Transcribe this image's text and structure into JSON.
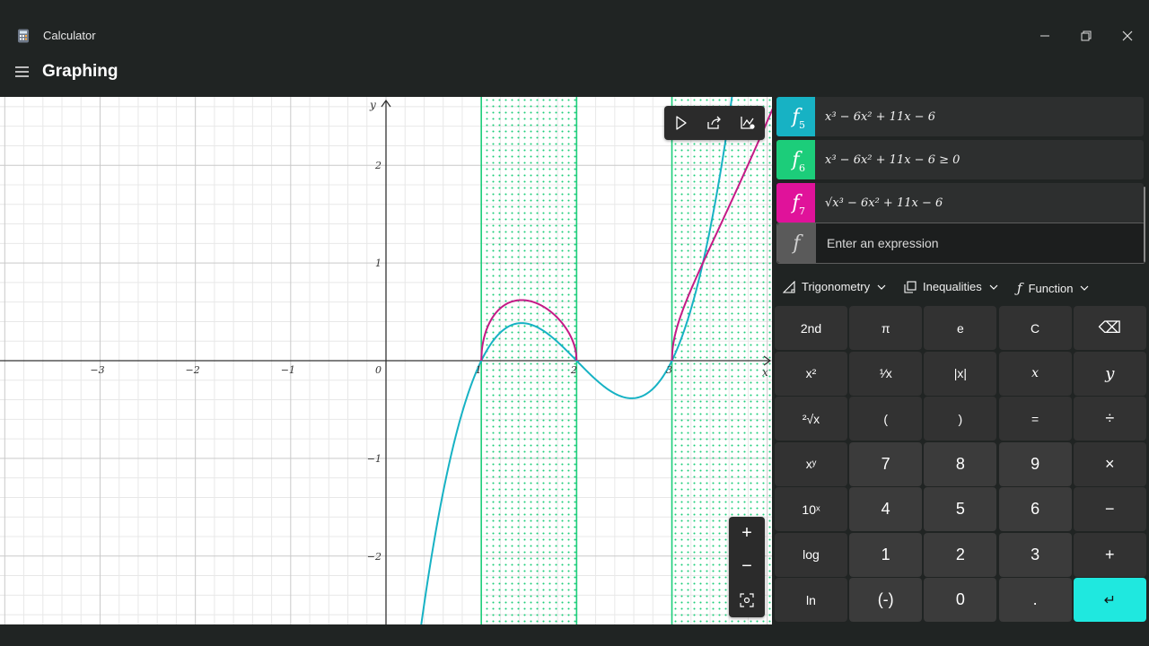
{
  "window": {
    "app_name": "Calculator",
    "minimize_icon": "minimize-icon",
    "maximize_icon": "restore-icon",
    "close_icon": "close-icon"
  },
  "header": {
    "mode_title": "Graphing",
    "menu_icon": "hamburger-icon"
  },
  "graph": {
    "x_axis_label": "x",
    "y_axis_label": "y",
    "x_ticks": [
      "−3",
      "−2",
      "−1",
      "0",
      "1",
      "2",
      "3"
    ],
    "y_ticks": [
      "2",
      "1",
      "−1",
      "−2"
    ],
    "x_range": [
      -4.05,
      4.05
    ],
    "y_range": [
      -2.7,
      2.7
    ],
    "grid": true,
    "curves": [
      {
        "name": "f5",
        "kind": "cubic",
        "color": "#17b2c4"
      },
      {
        "name": "f6",
        "kind": "inequality-region",
        "color": "#1ccd7a"
      },
      {
        "name": "f7",
        "kind": "sqrt-of-cubic",
        "color": "#c41a86"
      }
    ],
    "toolbar": [
      "trace-icon",
      "share-icon",
      "graph-options-icon"
    ],
    "zoom": {
      "in": "+",
      "out": "−",
      "fit": "zoom-fit-icon"
    }
  },
  "functions": [
    {
      "label": "f",
      "sub": "5",
      "color": "#17b2c4",
      "expr": "x³ − 6x² + 11x − 6"
    },
    {
      "label": "f",
      "sub": "6",
      "color": "#1ccd7a",
      "expr": "x³ − 6x² + 11x − 6 ≥ 0"
    },
    {
      "label": "f",
      "sub": "7",
      "color": "#e0129a",
      "expr": "√x³ − 6x² + 11x − 6"
    }
  ],
  "input": {
    "label": "f",
    "placeholder": "Enter an expression",
    "value": ""
  },
  "dropdowns": [
    {
      "label": "Trigonometry",
      "icon": "triangle-icon"
    },
    {
      "label": "Inequalities",
      "icon": "inequality-icon"
    },
    {
      "label": "Function",
      "icon": "function-icon"
    }
  ],
  "keypad": {
    "rows": [
      [
        "2nd",
        "π",
        "e",
        "C",
        "⌫"
      ],
      [
        "x²",
        "¹⁄x",
        "|x|",
        "x",
        "y"
      ],
      [
        "²√x",
        "(",
        ")",
        "=",
        "÷"
      ],
      [
        "xʸ",
        "7",
        "8",
        "9",
        "×"
      ],
      [
        "10ˣ",
        "4",
        "5",
        "6",
        "−"
      ],
      [
        "log",
        "1",
        "2",
        "3",
        "+"
      ],
      [
        "ln",
        "(-)",
        "0",
        ".",
        "↵"
      ]
    ]
  }
}
